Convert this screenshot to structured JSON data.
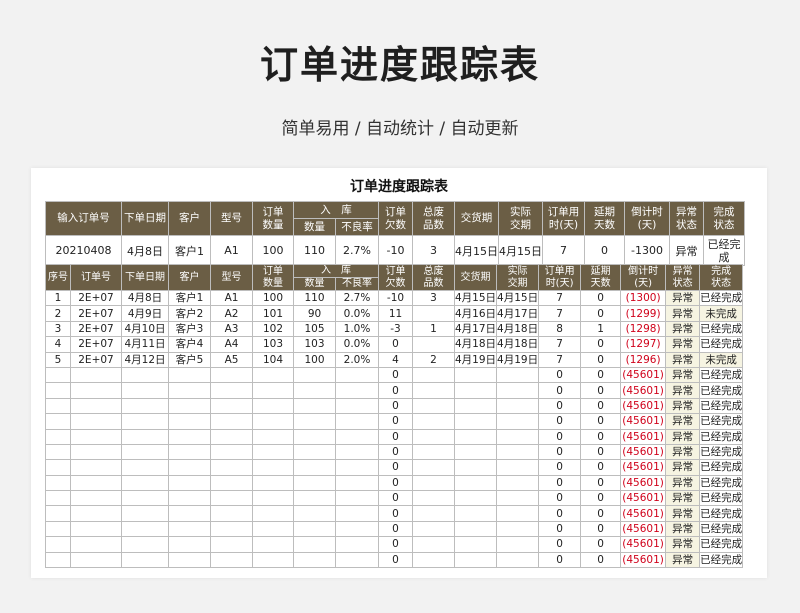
{
  "page": {
    "title": "订单进度跟踪表",
    "subtitle": "简单易用  /  自动统计  /  自动更新"
  },
  "sheet": {
    "title": "订单进度跟踪表",
    "top_headers": {
      "order_input": "输入订单号",
      "order_date": "下单日期",
      "customer": "客户",
      "model": "型号",
      "order_qty": "订单\n数量",
      "stock_in": "入　库",
      "qty": "数量",
      "defect_rate": "不良率",
      "shortfall": "订单\n欠数",
      "total_scrap": "总废\n品数",
      "delivery_date": "交货期",
      "actual_delivery": "实际\n交期",
      "order_time": "订单用\n时(天)",
      "delay_days": "延期\n天数",
      "countdown": "倒计时\n(天)",
      "abnormal_status": "异常\n状态",
      "complete_status": "完成\n状态"
    },
    "top_row": [
      "20210408",
      "4月8日",
      "客户1",
      "A1",
      "100",
      "110",
      "2.7%",
      "-10",
      "3",
      "4月15日",
      "4月15日",
      "7",
      "0",
      "-1300",
      "异常",
      "已经完成"
    ],
    "main_headers": {
      "seq": "序号",
      "order_no": "订单号",
      "order_date": "下单日期",
      "customer": "客户",
      "model": "型号",
      "order_qty": "订单\n数量",
      "stock_in": "入　库",
      "qty": "数量",
      "defect_rate": "不良率",
      "shortfall": "订单\n欠数",
      "total_scrap": "总废\n品数",
      "delivery_date": "交货期",
      "actual_delivery": "实际\n交期",
      "order_time": "订单用\n时(天)",
      "delay_days": "延期\n天数",
      "countdown": "倒计时\n(天)",
      "abnormal_status": "异常\n状态",
      "complete_status": "完成\n状态"
    },
    "rows": [
      [
        "1",
        "2E+07",
        "4月8日",
        "客户1",
        "A1",
        "100",
        "110",
        "2.7%",
        "-10",
        "3",
        "4月15日",
        "4月15日",
        "7",
        "0",
        "(1300)",
        "异常",
        "已经完成"
      ],
      [
        "2",
        "2E+07",
        "4月9日",
        "客户2",
        "A2",
        "101",
        "90",
        "0.0%",
        "11",
        "",
        "4月16日",
        "4月17日",
        "7",
        "0",
        "(1299)",
        "异常",
        "未完成"
      ],
      [
        "3",
        "2E+07",
        "4月10日",
        "客户3",
        "A3",
        "102",
        "105",
        "1.0%",
        "-3",
        "1",
        "4月17日",
        "4月18日",
        "8",
        "1",
        "(1298)",
        "异常",
        "已经完成"
      ],
      [
        "4",
        "2E+07",
        "4月11日",
        "客户4",
        "A4",
        "103",
        "103",
        "0.0%",
        "0",
        "",
        "4月18日",
        "4月18日",
        "7",
        "0",
        "(1297)",
        "异常",
        "已经完成"
      ],
      [
        "5",
        "2E+07",
        "4月12日",
        "客户5",
        "A5",
        "104",
        "100",
        "2.0%",
        "4",
        "2",
        "4月19日",
        "4月19日",
        "7",
        "0",
        "(1296)",
        "异常",
        "未完成"
      ],
      [
        "",
        "",
        "",
        "",
        "",
        "",
        "",
        "",
        "0",
        "",
        "",
        "",
        "0",
        "0",
        "(45601)",
        "异常",
        "已经完成"
      ],
      [
        "",
        "",
        "",
        "",
        "",
        "",
        "",
        "",
        "0",
        "",
        "",
        "",
        "0",
        "0",
        "(45601)",
        "异常",
        "已经完成"
      ],
      [
        "",
        "",
        "",
        "",
        "",
        "",
        "",
        "",
        "0",
        "",
        "",
        "",
        "0",
        "0",
        "(45601)",
        "异常",
        "已经完成"
      ],
      [
        "",
        "",
        "",
        "",
        "",
        "",
        "",
        "",
        "0",
        "",
        "",
        "",
        "0",
        "0",
        "(45601)",
        "异常",
        "已经完成"
      ],
      [
        "",
        "",
        "",
        "",
        "",
        "",
        "",
        "",
        "0",
        "",
        "",
        "",
        "0",
        "0",
        "(45601)",
        "异常",
        "已经完成"
      ],
      [
        "",
        "",
        "",
        "",
        "",
        "",
        "",
        "",
        "0",
        "",
        "",
        "",
        "0",
        "0",
        "(45601)",
        "异常",
        "已经完成"
      ],
      [
        "",
        "",
        "",
        "",
        "",
        "",
        "",
        "",
        "0",
        "",
        "",
        "",
        "0",
        "0",
        "(45601)",
        "异常",
        "已经完成"
      ],
      [
        "",
        "",
        "",
        "",
        "",
        "",
        "",
        "",
        "0",
        "",
        "",
        "",
        "0",
        "0",
        "(45601)",
        "异常",
        "已经完成"
      ],
      [
        "",
        "",
        "",
        "",
        "",
        "",
        "",
        "",
        "0",
        "",
        "",
        "",
        "0",
        "0",
        "(45601)",
        "异常",
        "已经完成"
      ],
      [
        "",
        "",
        "",
        "",
        "",
        "",
        "",
        "",
        "0",
        "",
        "",
        "",
        "0",
        "0",
        "(45601)",
        "异常",
        "已经完成"
      ],
      [
        "",
        "",
        "",
        "",
        "",
        "",
        "",
        "",
        "0",
        "",
        "",
        "",
        "0",
        "0",
        "(45601)",
        "异常",
        "已经完成"
      ],
      [
        "",
        "",
        "",
        "",
        "",
        "",
        "",
        "",
        "0",
        "",
        "",
        "",
        "0",
        "0",
        "(45601)",
        "异常",
        "已经完成"
      ],
      [
        "",
        "",
        "",
        "",
        "",
        "",
        "",
        "",
        "0",
        "",
        "",
        "",
        "0",
        "0",
        "(45601)",
        "异常",
        "已经完成"
      ]
    ],
    "colors": {
      "header_bg": "#6b5e45",
      "negative_text": "#d0021b",
      "status_bg": "#f6f4e2"
    }
  }
}
